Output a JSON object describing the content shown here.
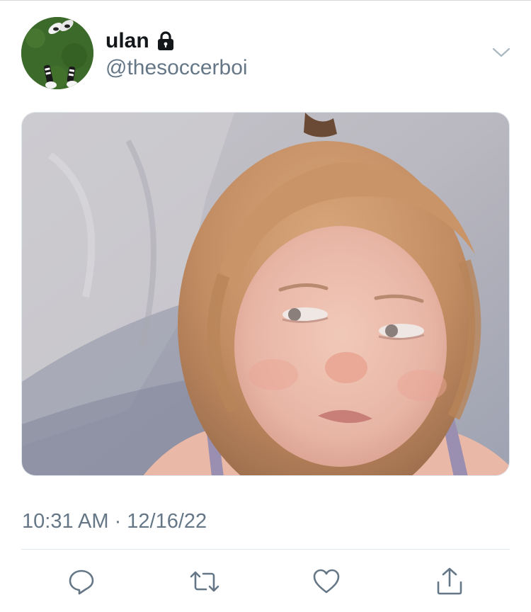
{
  "tweet": {
    "author": {
      "display_name": "ulan",
      "handle": "@thesoccerboi",
      "protected_icon": "lock-icon",
      "avatar_description_icon": "avatar"
    },
    "menu_icon": "chevron-down-icon",
    "timestamp": "10:31 AM · 12/16/22",
    "actions": [
      {
        "name": "reply",
        "icon": "reply-icon"
      },
      {
        "name": "retweet",
        "icon": "retweet-icon"
      },
      {
        "name": "like",
        "icon": "heart-icon"
      },
      {
        "name": "share",
        "icon": "share-icon"
      }
    ]
  },
  "colors": {
    "text_primary": "#14171a",
    "text_secondary": "#657786",
    "divider": "#e1e8ed",
    "icon": "#657786"
  }
}
